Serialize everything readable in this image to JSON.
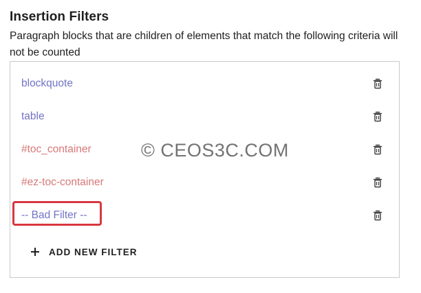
{
  "section": {
    "title": "Insertion Filters",
    "description": "Paragraph blocks that are children of elements that match the following criteria will not be counted"
  },
  "filters": [
    {
      "label": "blockquote",
      "color": "#7173c4"
    },
    {
      "label": "table",
      "color": "#7173c4"
    },
    {
      "label": "#toc_container",
      "color": "#d97878"
    },
    {
      "label": "#ez-toc-container",
      "color": "#d97878"
    },
    {
      "label": "-- Bad Filter --",
      "color": "#7173c4"
    }
  ],
  "add_button": {
    "label": "ADD NEW FILTER"
  },
  "watermark": {
    "text": "© CEOS3C.COM"
  },
  "icons": {
    "delete": "trash-icon",
    "add": "plus-icon"
  },
  "colors": {
    "element_filter": "#7173c4",
    "id_filter": "#d97878",
    "highlight": "#d9363e",
    "panel_border": "#c9c9c9"
  }
}
